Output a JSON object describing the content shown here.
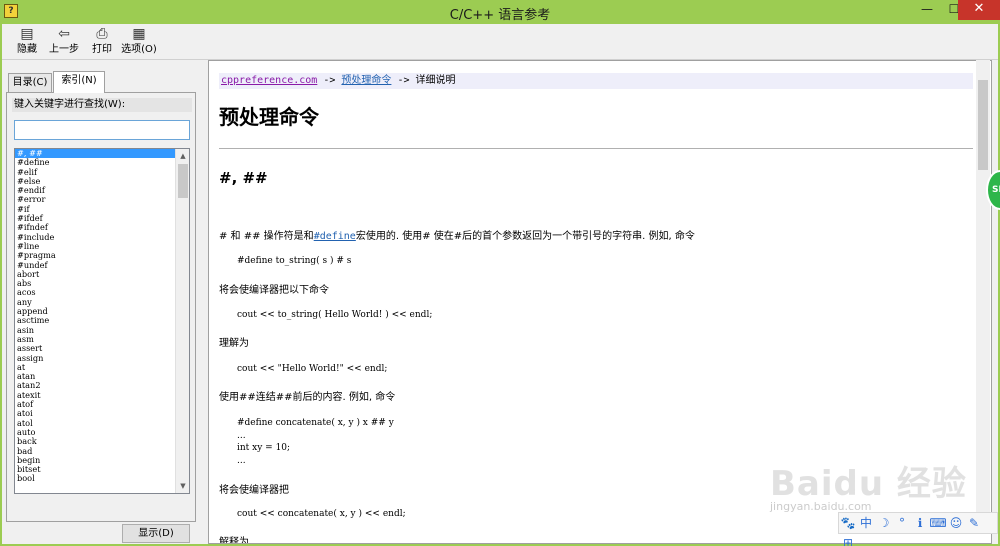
{
  "window": {
    "title": "C/C++ 语言参考",
    "minimize_glyph": "—",
    "maximize_glyph": "☐",
    "close_glyph": "✕"
  },
  "toolbar": {
    "hide_label": "隐藏",
    "back_label": "上一步",
    "print_label": "打印",
    "options_label": "选项(O)"
  },
  "left_pane": {
    "tab_contents": "目录(C)",
    "tab_index": "索引(N)",
    "keyword_label": "键入关键字进行查找(W):",
    "search_value": "",
    "items": [
      "#, ##",
      "#define",
      "#elif",
      "#else",
      "#endif",
      "#error",
      "#if",
      "#ifdef",
      "#ifndef",
      "#include",
      "#line",
      "#pragma",
      "#undef",
      "abort",
      "abs",
      "acos",
      "any",
      "append",
      "asctime",
      "asin",
      "asm",
      "assert",
      "assign",
      "at",
      "atan",
      "atan2",
      "atexit",
      "atof",
      "atoi",
      "atol",
      "auto",
      "back",
      "bad",
      "begin",
      "bitset",
      "bool"
    ],
    "selected_index": 0,
    "display_button": "显示(D)"
  },
  "content": {
    "breadcrumb": {
      "site": "cppreference.com",
      "arrow1": " -> ",
      "section": "预处理命令",
      "arrow2": " -> ",
      "current": "详细说明"
    },
    "page_title": "预处理命令",
    "section_title": "#, ##",
    "p1_before": "# 和 ## 操作符是和",
    "p1_link": "#define",
    "p1_after": "宏使用的. 使用# 使在#后的首个参数返回为一个带引号的字符串. 例如, 命令",
    "code1": "#define to_string( s ) # s",
    "p2": "将会使编译器把以下命令",
    "code2": "cout << to_string( Hello World! ) << endl;",
    "p3": "理解为",
    "code3": "cout << \"Hello World!\" << endl;",
    "p4": "使用##连结##前后的内容. 例如, 命令",
    "code4": "#define concatenate( x, y ) x ## y\n...\nint xy = 10;\n...",
    "p5": "将会使编译器把",
    "code5": "cout << concatenate( x, y ) << endl;",
    "p6": "解释为"
  },
  "overlays": {
    "badge_text": "SE",
    "watermark": "Baidu 经验",
    "watermark_sub": "jingyan.baidu.com",
    "ime_glyphs": [
      "🐾",
      "中",
      "☽",
      "°",
      "ℹ",
      "⌨",
      "☺",
      "✎",
      "⊞"
    ]
  }
}
